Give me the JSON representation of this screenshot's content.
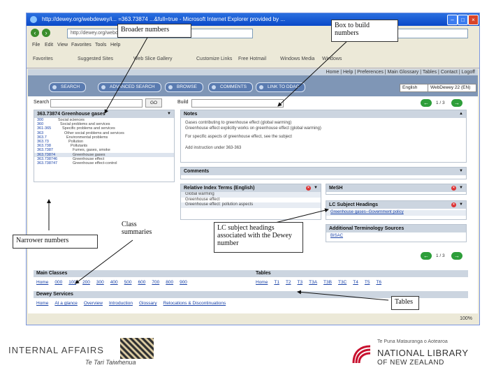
{
  "browser": {
    "title": "http://dewey.org/webdewey/i... =363.73874 ...&full=true - Microsoft Internet Explorer provided by ...",
    "address": "http://dewey.org/webdewey/index.php?...",
    "menu": [
      "File",
      "Edit",
      "View",
      "Favorites",
      "Tools",
      "Help"
    ],
    "favorites_label": "Favorites",
    "tabs": [
      "Suggested Sites",
      "Web Slice Gallery",
      "Customize Links",
      "Free Hotmail",
      "Windows Media",
      "Windows"
    ],
    "status": "100%"
  },
  "page": {
    "topnav": "Home | Help | Preferences | Main Glossary | Tables | Contact | Logoff",
    "buttons": [
      "SEARCH",
      "ADVANCED SEARCH",
      "BROWSE",
      "COMMENTS",
      "LINK TO DDAC"
    ],
    "language": "English",
    "edition": "WebDewey 22 (EN)",
    "search_label": "Search",
    "go_label": "GO",
    "build_label": "Build",
    "pager_top": "1 / 3",
    "pager_mid": "1 / 3",
    "hierarchy_title": "363.73874 Greenhouse gases",
    "hierarchy": [
      {
        "num": "300",
        "text": "Social sciences"
      },
      {
        "num": "360",
        "text": "Social problems and services"
      },
      {
        "num": "361-365",
        "text": "Specific problems and services"
      },
      {
        "num": "363",
        "text": "Other social problems and services"
      },
      {
        "num": "363.7",
        "text": "Environmental problems"
      },
      {
        "num": "363.73",
        "text": "Pollution"
      },
      {
        "num": "363.738",
        "text": "Pollutants"
      },
      {
        "num": "363.7387",
        "text": "Fumes, gases, smoke"
      },
      {
        "num": "363.73874",
        "text": "Greenhouse gases"
      },
      {
        "num": "363.738746",
        "text": "Greenhouse effect"
      },
      {
        "num": "363.738747",
        "text": "Greenhouse effect-control"
      }
    ],
    "notes_title": "Notes",
    "notes": [
      "Gases contributing to greenhouse effect (global warming)",
      "Greenhouse effect explicitly works on greenhouse effect (global warming)",
      "For specific aspects of greenhouse effect, see the subject",
      "Add instruction under 363-363"
    ],
    "comments_title": "Comments",
    "rit_title": "Relative Index Terms (English)",
    "rit": [
      "Global warming",
      "Greenhouse effect",
      "Greenhouse effect: pollution aspects"
    ],
    "mesh_title": "MeSH",
    "lcsh_title": "LC Subject Headings",
    "lcsh": [
      "Greenhouse gases--Government policy"
    ],
    "ats_title": "Additional Terminology Sources",
    "ats": [
      "BISAC"
    ],
    "main_classes_title": "Main Classes",
    "main_classes": [
      "Home",
      "000",
      "100",
      "200",
      "300",
      "400",
      "500",
      "600",
      "700",
      "800",
      "900"
    ],
    "tables_title": "Tables",
    "tables": [
      "Home",
      "T1",
      "T2",
      "T3",
      "T3A",
      "T3B",
      "T3C",
      "T4",
      "T5",
      "T6"
    ],
    "dewey_services_title": "Dewey Services",
    "dewey_services": [
      "Home",
      "At a glance",
      "Overview",
      "Introduction",
      "Glossary",
      "Relocations & Discontinuations"
    ]
  },
  "callouts": {
    "broader": "Broader numbers",
    "box": "Box to build numbers",
    "narrower": "Narrower numbers",
    "class_summaries": "Class summaries",
    "lcsh_assoc": "LC subject headings associated with the Dewey number",
    "tables": "Tables"
  },
  "footer": {
    "ia": "INTERNAL AFFAIRS",
    "ia_maori": "Te Tari Taiwhenua",
    "nl_maori": "Te Puna Matauranga o Aotearoa",
    "nl_line1": "NATIONAL LIBRARY",
    "nl_line2": "OF NEW ZEALAND"
  }
}
